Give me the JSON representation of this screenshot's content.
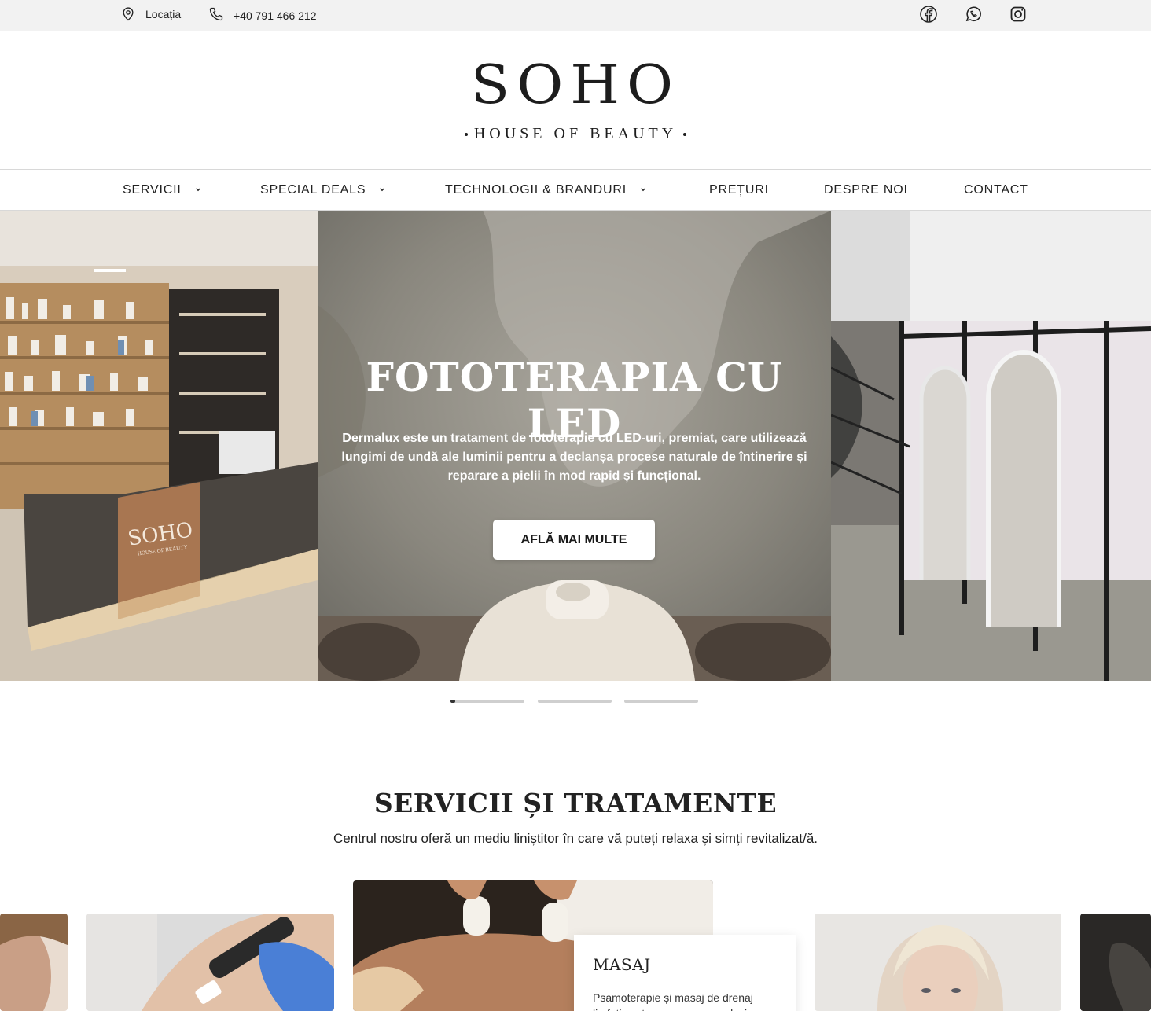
{
  "topbar": {
    "location_label": "Locația",
    "phone_label": "+40 791 466 212",
    "social": [
      "facebook-icon",
      "whatsapp-icon",
      "instagram-icon"
    ]
  },
  "logo": {
    "main": "SOHO",
    "sub": "HOUSE OF BEAUTY"
  },
  "nav": {
    "items": [
      {
        "label": "SERVICII",
        "dropdown": true
      },
      {
        "label": "SPECIAL DEALS",
        "dropdown": true
      },
      {
        "label": "TECHNOLOGII & BRANDURI",
        "dropdown": true
      },
      {
        "label": "PREȚURI",
        "dropdown": false
      },
      {
        "label": "DESPRE NOI",
        "dropdown": false
      },
      {
        "label": "CONTACT",
        "dropdown": false
      }
    ]
  },
  "hero": {
    "title": "FOTOTERAPIA CU LED",
    "text": "Dermalux este un tratament de fototerapie cu LED-uri, premiat, care utilizează lungimi de undă ale luminii pentru a declanșa procese naturale de întinerire și reparare a pielii în mod rapid și funcțional.",
    "button_label": "AFLĂ MAI MULTE",
    "desk_sign_main": "SOHO",
    "desk_sign_sub": "HOUSE OF BEAUTY",
    "slide_count": 3,
    "active_slide": 1
  },
  "services": {
    "title": "SERVICII ȘI TRATAMENTE",
    "subtitle": "Centrul nostru oferă un mediu liniștitor în care vă puteți relaxa și simți revitalizat/ă.",
    "featured": {
      "title": "MASAJ",
      "text": "Psamoterapie și masaj de drenaj limfatic este un program exclusiv"
    }
  },
  "colors": {
    "topbar_bg": "#f2f2f2",
    "text": "#1a1a1a",
    "divider": "#d8d8d8"
  }
}
